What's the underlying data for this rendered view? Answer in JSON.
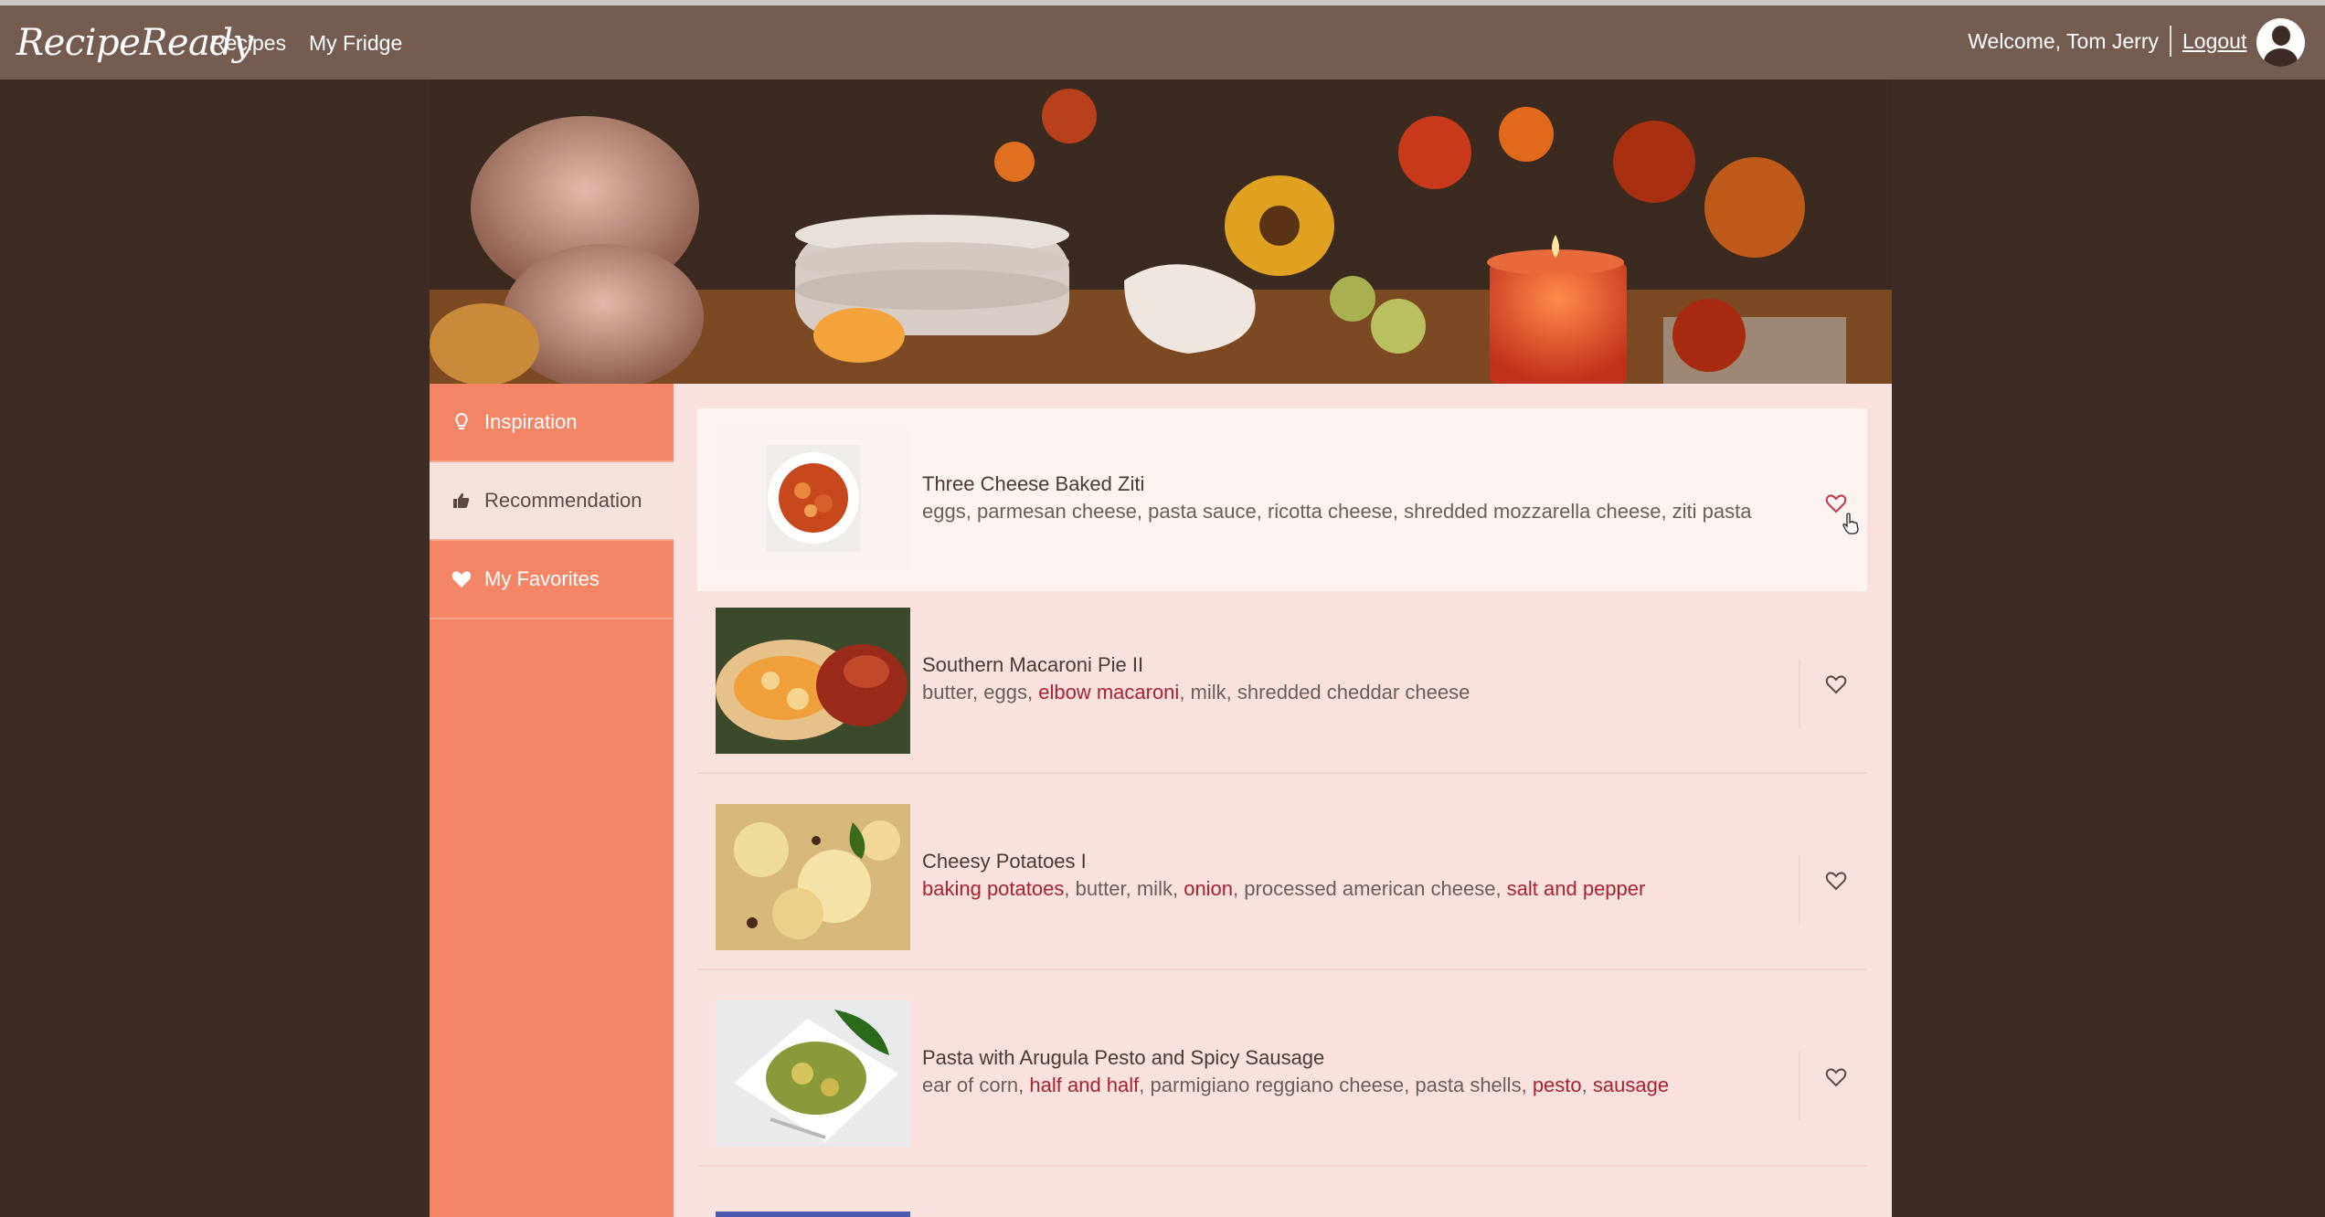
{
  "app": {
    "logo": "RecipeReady",
    "nav": [
      {
        "label": "Recipes"
      },
      {
        "label": "My Fridge"
      }
    ],
    "welcome": "Welcome, Tom Jerry",
    "logout": "Logout"
  },
  "sidebar": {
    "items": [
      {
        "label": "Inspiration",
        "icon": "lightbulb-icon",
        "active": false
      },
      {
        "label": "Recommendation",
        "icon": "thumbs-up-icon",
        "active": true
      },
      {
        "label": "My Favorites",
        "icon": "heart-icon",
        "active": false
      }
    ]
  },
  "recipes": [
    {
      "title": "Three Cheese Baked Ziti",
      "ingredients": [
        {
          "text": "eggs",
          "missing": false
        },
        {
          "text": "parmesan cheese",
          "missing": false
        },
        {
          "text": "pasta sauce",
          "missing": false
        },
        {
          "text": "ricotta cheese",
          "missing": false
        },
        {
          "text": "shredded mozzarella cheese",
          "missing": false
        },
        {
          "text": "ziti pasta",
          "missing": false
        }
      ],
      "favorite_color": "#c0394b"
    },
    {
      "title": "Southern Macaroni Pie II",
      "ingredients": [
        {
          "text": "butter",
          "missing": false
        },
        {
          "text": "eggs",
          "missing": false
        },
        {
          "text": "elbow macaroni",
          "missing": true
        },
        {
          "text": "milk",
          "missing": false
        },
        {
          "text": "shredded cheddar cheese",
          "missing": false
        }
      ],
      "favorite_color": "#5e4a42"
    },
    {
      "title": "Cheesy Potatoes I",
      "ingredients": [
        {
          "text": "baking potatoes",
          "missing": true
        },
        {
          "text": "butter",
          "missing": false
        },
        {
          "text": "milk",
          "missing": false
        },
        {
          "text": "onion",
          "missing": true
        },
        {
          "text": "processed american cheese",
          "missing": false
        },
        {
          "text": "salt and pepper",
          "missing": true
        }
      ],
      "favorite_color": "#5e4a42"
    },
    {
      "title": "Pasta with Arugula Pesto and Spicy Sausage",
      "ingredients": [
        {
          "text": "ear of corn",
          "missing": false
        },
        {
          "text": "half and half",
          "missing": true
        },
        {
          "text": "parmigiano reggiano cheese",
          "missing": false
        },
        {
          "text": "pasta shells",
          "missing": false
        },
        {
          "text": "pesto",
          "missing": true
        },
        {
          "text": "sausage",
          "missing": true
        }
      ],
      "favorite_color": "#5e4a42"
    }
  ],
  "colors": {
    "navbar": "#745c51",
    "background": "#3d2c25",
    "sidebar": "#f48567",
    "content": "#f9e1de",
    "missing_ingredient": "#a8222f"
  }
}
